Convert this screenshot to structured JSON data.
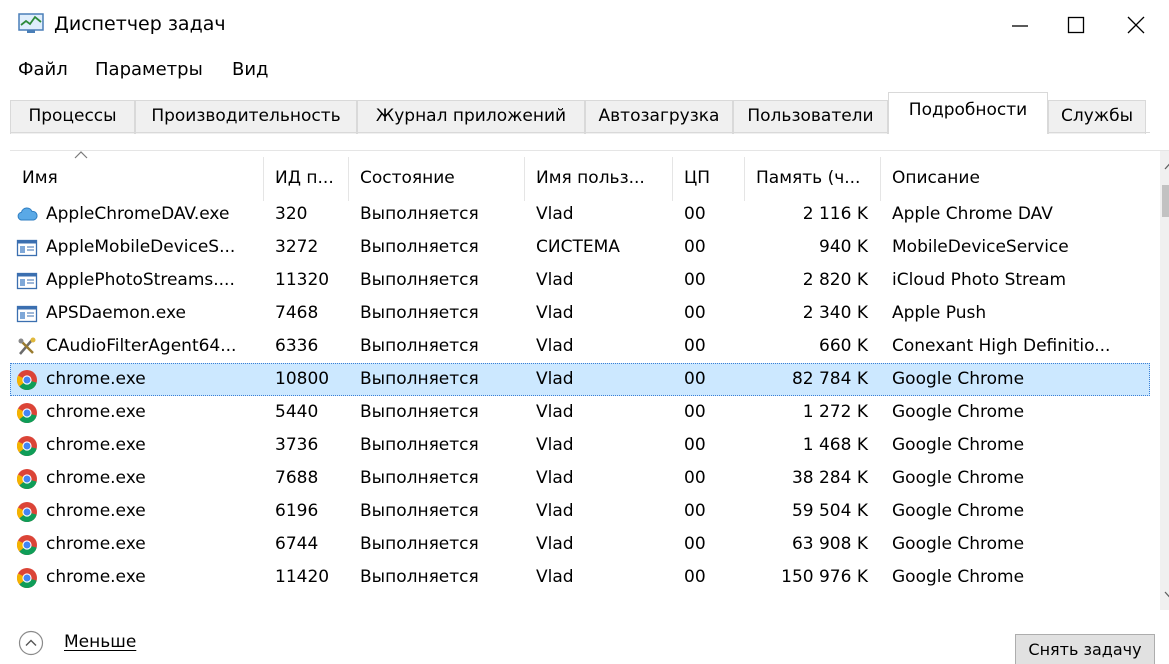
{
  "window": {
    "title": "Диспетчер задач"
  },
  "menu": [
    "Файл",
    "Параметры",
    "Вид"
  ],
  "tabs": [
    {
      "label": "Процессы",
      "active": false
    },
    {
      "label": "Производительность",
      "active": false
    },
    {
      "label": "Журнал приложений",
      "active": false
    },
    {
      "label": "Автозагрузка",
      "active": false
    },
    {
      "label": "Пользователи",
      "active": false
    },
    {
      "label": "Подробности",
      "active": true
    },
    {
      "label": "Службы",
      "active": false
    }
  ],
  "table": {
    "columns": [
      "Имя",
      "ИД п...",
      "Состояние",
      "Имя польз...",
      "ЦП",
      "Память (ч...",
      "Описание"
    ],
    "rows": [
      {
        "icon": "cloud-app-icon",
        "name": "AppleChromeDAV.exe",
        "pid": "320",
        "status": "Выполняется",
        "user": "Vlad",
        "cpu": "00",
        "memory": "2 116 K",
        "description": "Apple Chrome DAV"
      },
      {
        "icon": "service-window-icon",
        "name": "AppleMobileDeviceS...",
        "pid": "3272",
        "status": "Выполняется",
        "user": "СИСТЕМА",
        "cpu": "00",
        "memory": "940 K",
        "description": "MobileDeviceService"
      },
      {
        "icon": "service-window-icon",
        "name": "ApplePhotoStreams....",
        "pid": "11320",
        "status": "Выполняется",
        "user": "Vlad",
        "cpu": "00",
        "memory": "2 820 K",
        "description": "iCloud Photo Stream"
      },
      {
        "icon": "service-window-icon",
        "name": "APSDaemon.exe",
        "pid": "7468",
        "status": "Выполняется",
        "user": "Vlad",
        "cpu": "00",
        "memory": "2 340 K",
        "description": "Apple Push"
      },
      {
        "icon": "audio-tools-icon",
        "name": "CAudioFilterAgent64...",
        "pid": "6336",
        "status": "Выполняется",
        "user": "Vlad",
        "cpu": "00",
        "memory": "660 K",
        "description": "Conexant High Definitio..."
      },
      {
        "icon": "chrome-icon",
        "name": "chrome.exe",
        "pid": "10800",
        "status": "Выполняется",
        "user": "Vlad",
        "cpu": "00",
        "memory": "82 784 K",
        "description": "Google Chrome",
        "selected": true
      },
      {
        "icon": "chrome-icon",
        "name": "chrome.exe",
        "pid": "5440",
        "status": "Выполняется",
        "user": "Vlad",
        "cpu": "00",
        "memory": "1 272 K",
        "description": "Google Chrome"
      },
      {
        "icon": "chrome-icon",
        "name": "chrome.exe",
        "pid": "3736",
        "status": "Выполняется",
        "user": "Vlad",
        "cpu": "00",
        "memory": "1 468 K",
        "description": "Google Chrome"
      },
      {
        "icon": "chrome-icon",
        "name": "chrome.exe",
        "pid": "7688",
        "status": "Выполняется",
        "user": "Vlad",
        "cpu": "00",
        "memory": "38 284 K",
        "description": "Google Chrome"
      },
      {
        "icon": "chrome-icon",
        "name": "chrome.exe",
        "pid": "6196",
        "status": "Выполняется",
        "user": "Vlad",
        "cpu": "00",
        "memory": "59 504 K",
        "description": "Google Chrome"
      },
      {
        "icon": "chrome-icon",
        "name": "chrome.exe",
        "pid": "6744",
        "status": "Выполняется",
        "user": "Vlad",
        "cpu": "00",
        "memory": "63 908 K",
        "description": "Google Chrome"
      },
      {
        "icon": "chrome-icon",
        "name": "chrome.exe",
        "pid": "11420",
        "status": "Выполняется",
        "user": "Vlad",
        "cpu": "00",
        "memory": "150 976 K",
        "description": "Google Chrome"
      }
    ]
  },
  "footer": {
    "less_label": "Меньше",
    "end_task_label": "Снять задачу"
  },
  "colors": {
    "selected_row": "#cce8ff",
    "tab_inactive": "#f0f0f0"
  }
}
